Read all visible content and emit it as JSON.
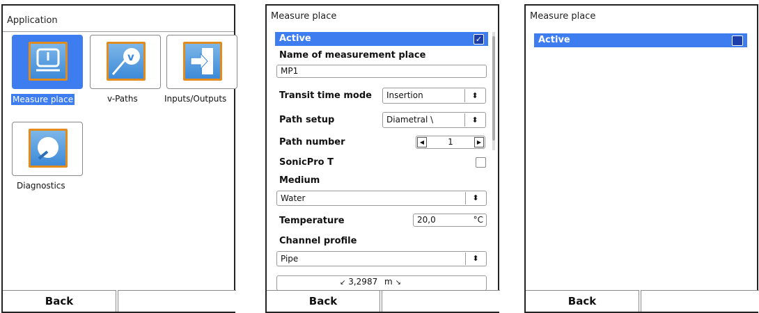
{
  "screen1": {
    "title": "Application",
    "tiles": [
      {
        "label": "Measure place"
      },
      {
        "label": "v-Paths"
      },
      {
        "label": "Inputs/Outputs"
      },
      {
        "label": "Diagnostics"
      }
    ],
    "softkeys": {
      "left": "Back",
      "right": ""
    }
  },
  "screen2": {
    "title": "Measure place",
    "active_label": "Active",
    "name_label": "Name of measurement place",
    "name_value": "MP1",
    "transit_label": "Transit time mode",
    "transit_value": "Insertion",
    "path_setup_label": "Path setup",
    "path_setup_value": "Diametral \\",
    "path_number_label": "Path number",
    "path_number_value": "1",
    "sonicpro_label": "SonicPro T",
    "medium_label": "Medium",
    "medium_value": "Water",
    "temperature_label": "Temperature",
    "temperature_value": "20,0",
    "temperature_unit": "°C",
    "channel_label": "Channel profile",
    "channel_value": "Pipe",
    "dimension_value": "3,2987",
    "dimension_unit": "m",
    "softkeys": {
      "left": "Back",
      "right": ""
    }
  },
  "screen3": {
    "title": "Measure place",
    "active_label": "Active",
    "softkeys": {
      "left": "Back",
      "right": ""
    }
  },
  "colors": {
    "accent": "#3d7df0",
    "icon_border": "#e28c1d",
    "checkbox": "#1e3ea8"
  }
}
